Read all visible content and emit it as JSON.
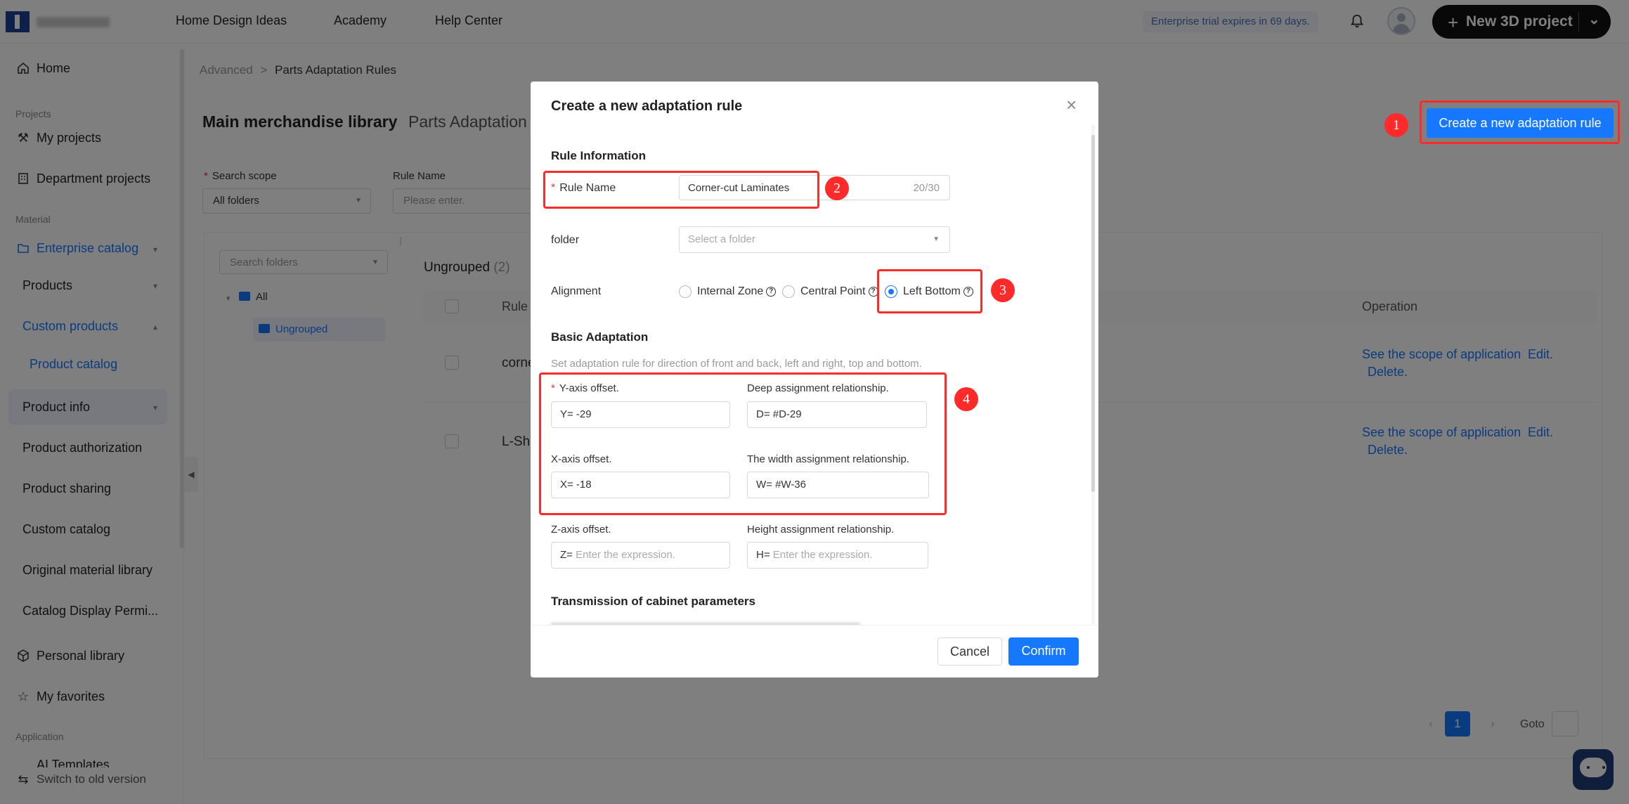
{
  "topbar": {
    "nav": [
      "Home Design Ideas",
      "Academy",
      "Help Center"
    ],
    "trial": "Enterprise trial expires in 69 days.",
    "new_project": "New 3D project"
  },
  "sidebar": {
    "home": "Home",
    "sec_projects": "Projects",
    "my_projects": "My projects",
    "department_projects": "Department projects",
    "sec_material": "Material",
    "enterprise_catalog": "Enterprise catalog",
    "products": "Products",
    "custom_products": "Custom products",
    "product_catalog": "Product catalog",
    "product_info": "Product info",
    "product_authorization": "Product authorization",
    "product_sharing": "Product sharing",
    "custom_catalog": "Custom catalog",
    "original_material_library": "Original material library",
    "catalog_display": "Catalog Display Permi...",
    "personal_library": "Personal library",
    "my_favorites": "My favorites",
    "sec_application": "Application",
    "ai_templates": "AI Templates",
    "switch_old": "Switch to old version"
  },
  "page": {
    "breadcrumb_root": "Advanced",
    "breadcrumb_sep": ">",
    "breadcrumb_current": "Parts Adaptation Rules",
    "tab_main": "Main merchandise library",
    "tab_parts": "Parts Adaptation",
    "create_button": "Create a new adaptation rule",
    "search_scope_label": "Search scope",
    "search_scope_value": "All folders",
    "rule_name_label": "Rule Name",
    "rule_name_placeholder": "Please enter.",
    "search_folders_placeholder": "Search folders",
    "tree_all": "All",
    "tree_ungrouped": "Ungrouped",
    "list_title": "Ungrouped",
    "list_count": "(2)",
    "col_rule": "Rule",
    "col_operation": "Operation",
    "rows": [
      {
        "name": "corne",
        "scope_link": "See the scope of application",
        "edit": "Edit.",
        "delete": "Delete."
      },
      {
        "name": "L-Sh",
        "scope_link": "See the scope of application",
        "edit": "Edit.",
        "delete": "Delete."
      }
    ],
    "pager_current": "1",
    "goto_label": "Goto"
  },
  "modal": {
    "title": "Create a new adaptation rule",
    "section_rule_info": "Rule Information",
    "rule_name_label": "Rule Name",
    "rule_name_value": "Corner-cut Laminates",
    "rule_name_count": "20/30",
    "folder_label": "folder",
    "folder_placeholder": "Select a folder",
    "alignment_label": "Alignment",
    "alignment_options": [
      "Internal Zone",
      "Central Point",
      "Left Bottom"
    ],
    "alignment_selected": "Left Bottom",
    "section_basic": "Basic Adaptation",
    "basic_hint": "Set adaptation rule for direction of front and back, left and right, top and bottom.",
    "y_label": "Y-axis offset.",
    "y_value": "Y= -29",
    "d_label": "Deep assignment relationship.",
    "d_value": "D= #D-29",
    "x_label": "X-axis offset.",
    "x_value": "X= -18",
    "w_label": "The width assignment relationship.",
    "w_value": "W= #W-36",
    "z_label": "Z-axis offset.",
    "z_prefix": "Z=",
    "z_placeholder": "Enter the expression.",
    "h_label": "Height assignment relationship.",
    "h_prefix": "H=",
    "h_placeholder": "Enter the expression.",
    "section_transmission": "Transmission of cabinet parameters",
    "cancel": "Cancel",
    "confirm": "Confirm"
  },
  "annotations": [
    "1",
    "2",
    "3",
    "4"
  ],
  "colors": {
    "primary": "#1677ff",
    "highlight": "#ff2a2a",
    "brand": "#1c3f94"
  }
}
